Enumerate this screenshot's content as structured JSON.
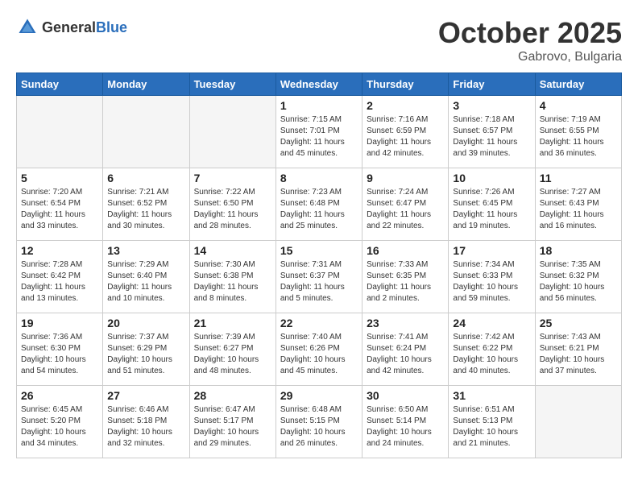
{
  "header": {
    "logo_general": "General",
    "logo_blue": "Blue",
    "month": "October 2025",
    "location": "Gabrovo, Bulgaria"
  },
  "days_of_week": [
    "Sunday",
    "Monday",
    "Tuesday",
    "Wednesday",
    "Thursday",
    "Friday",
    "Saturday"
  ],
  "weeks": [
    [
      {
        "day": "",
        "info": "",
        "empty": true
      },
      {
        "day": "",
        "info": "",
        "empty": true
      },
      {
        "day": "",
        "info": "",
        "empty": true
      },
      {
        "day": "1",
        "info": "Sunrise: 7:15 AM\nSunset: 7:01 PM\nDaylight: 11 hours and 45 minutes."
      },
      {
        "day": "2",
        "info": "Sunrise: 7:16 AM\nSunset: 6:59 PM\nDaylight: 11 hours and 42 minutes."
      },
      {
        "day": "3",
        "info": "Sunrise: 7:18 AM\nSunset: 6:57 PM\nDaylight: 11 hours and 39 minutes."
      },
      {
        "day": "4",
        "info": "Sunrise: 7:19 AM\nSunset: 6:55 PM\nDaylight: 11 hours and 36 minutes."
      }
    ],
    [
      {
        "day": "5",
        "info": "Sunrise: 7:20 AM\nSunset: 6:54 PM\nDaylight: 11 hours and 33 minutes."
      },
      {
        "day": "6",
        "info": "Sunrise: 7:21 AM\nSunset: 6:52 PM\nDaylight: 11 hours and 30 minutes."
      },
      {
        "day": "7",
        "info": "Sunrise: 7:22 AM\nSunset: 6:50 PM\nDaylight: 11 hours and 28 minutes."
      },
      {
        "day": "8",
        "info": "Sunrise: 7:23 AM\nSunset: 6:48 PM\nDaylight: 11 hours and 25 minutes."
      },
      {
        "day": "9",
        "info": "Sunrise: 7:24 AM\nSunset: 6:47 PM\nDaylight: 11 hours and 22 minutes."
      },
      {
        "day": "10",
        "info": "Sunrise: 7:26 AM\nSunset: 6:45 PM\nDaylight: 11 hours and 19 minutes."
      },
      {
        "day": "11",
        "info": "Sunrise: 7:27 AM\nSunset: 6:43 PM\nDaylight: 11 hours and 16 minutes."
      }
    ],
    [
      {
        "day": "12",
        "info": "Sunrise: 7:28 AM\nSunset: 6:42 PM\nDaylight: 11 hours and 13 minutes."
      },
      {
        "day": "13",
        "info": "Sunrise: 7:29 AM\nSunset: 6:40 PM\nDaylight: 11 hours and 10 minutes."
      },
      {
        "day": "14",
        "info": "Sunrise: 7:30 AM\nSunset: 6:38 PM\nDaylight: 11 hours and 8 minutes."
      },
      {
        "day": "15",
        "info": "Sunrise: 7:31 AM\nSunset: 6:37 PM\nDaylight: 11 hours and 5 minutes."
      },
      {
        "day": "16",
        "info": "Sunrise: 7:33 AM\nSunset: 6:35 PM\nDaylight: 11 hours and 2 minutes."
      },
      {
        "day": "17",
        "info": "Sunrise: 7:34 AM\nSunset: 6:33 PM\nDaylight: 10 hours and 59 minutes."
      },
      {
        "day": "18",
        "info": "Sunrise: 7:35 AM\nSunset: 6:32 PM\nDaylight: 10 hours and 56 minutes."
      }
    ],
    [
      {
        "day": "19",
        "info": "Sunrise: 7:36 AM\nSunset: 6:30 PM\nDaylight: 10 hours and 54 minutes."
      },
      {
        "day": "20",
        "info": "Sunrise: 7:37 AM\nSunset: 6:29 PM\nDaylight: 10 hours and 51 minutes."
      },
      {
        "day": "21",
        "info": "Sunrise: 7:39 AM\nSunset: 6:27 PM\nDaylight: 10 hours and 48 minutes."
      },
      {
        "day": "22",
        "info": "Sunrise: 7:40 AM\nSunset: 6:26 PM\nDaylight: 10 hours and 45 minutes."
      },
      {
        "day": "23",
        "info": "Sunrise: 7:41 AM\nSunset: 6:24 PM\nDaylight: 10 hours and 42 minutes."
      },
      {
        "day": "24",
        "info": "Sunrise: 7:42 AM\nSunset: 6:22 PM\nDaylight: 10 hours and 40 minutes."
      },
      {
        "day": "25",
        "info": "Sunrise: 7:43 AM\nSunset: 6:21 PM\nDaylight: 10 hours and 37 minutes."
      }
    ],
    [
      {
        "day": "26",
        "info": "Sunrise: 6:45 AM\nSunset: 5:20 PM\nDaylight: 10 hours and 34 minutes."
      },
      {
        "day": "27",
        "info": "Sunrise: 6:46 AM\nSunset: 5:18 PM\nDaylight: 10 hours and 32 minutes."
      },
      {
        "day": "28",
        "info": "Sunrise: 6:47 AM\nSunset: 5:17 PM\nDaylight: 10 hours and 29 minutes."
      },
      {
        "day": "29",
        "info": "Sunrise: 6:48 AM\nSunset: 5:15 PM\nDaylight: 10 hours and 26 minutes."
      },
      {
        "day": "30",
        "info": "Sunrise: 6:50 AM\nSunset: 5:14 PM\nDaylight: 10 hours and 24 minutes."
      },
      {
        "day": "31",
        "info": "Sunrise: 6:51 AM\nSunset: 5:13 PM\nDaylight: 10 hours and 21 minutes."
      },
      {
        "day": "",
        "info": "",
        "empty": true
      }
    ]
  ]
}
